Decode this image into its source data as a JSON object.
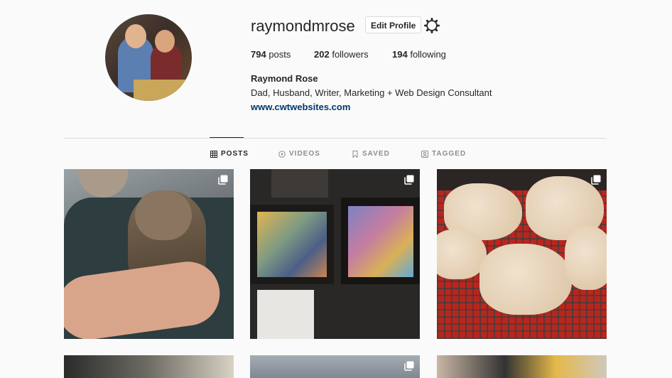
{
  "profile": {
    "username": "raymondmrose",
    "edit_label": "Edit Profile",
    "full_name": "Raymond Rose",
    "bio": "Dad, Husband, Writer, Marketing + Web Design Consultant",
    "website": "www.cwtwebsites.com"
  },
  "stats": {
    "posts": {
      "count": "794",
      "label": "posts"
    },
    "followers": {
      "count": "202",
      "label": "followers"
    },
    "following": {
      "count": "194",
      "label": "following"
    }
  },
  "tabs": [
    {
      "label": "POSTS",
      "icon": "grid-icon",
      "active": true
    },
    {
      "label": "VIDEOS",
      "icon": "video-icon",
      "active": false
    },
    {
      "label": "SAVED",
      "icon": "bookmark-icon",
      "active": false
    },
    {
      "label": "TAGGED",
      "icon": "tag-user-icon",
      "active": false
    }
  ],
  "posts": [
    {
      "content": "photo-cat",
      "multi": true
    },
    {
      "content": "photo-paintings",
      "multi": true
    },
    {
      "content": "photo-scones",
      "multi": true
    },
    {
      "content": "photo-sign",
      "multi": false
    },
    {
      "content": "photo-sky",
      "multi": true
    },
    {
      "content": "photo-kitchen",
      "multi": false
    }
  ],
  "colors": {
    "background": "#fafafa",
    "text": "#262626",
    "muted": "#8e8e8e",
    "link": "#00376b",
    "border": "#dbdbdb"
  }
}
